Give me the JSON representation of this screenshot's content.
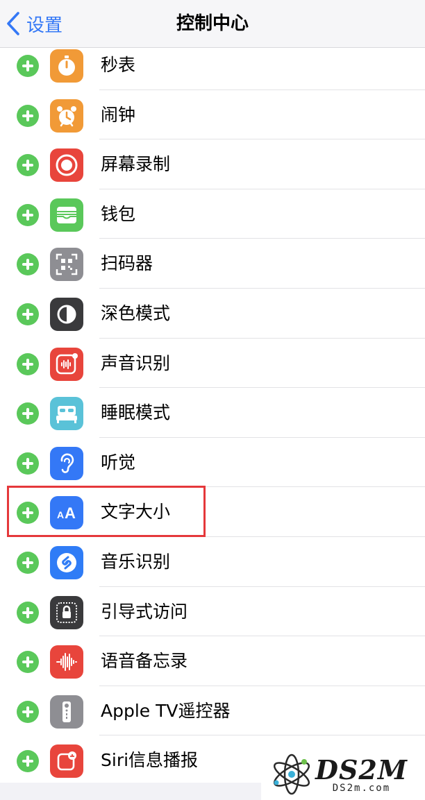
{
  "nav": {
    "back_label": "设置",
    "title": "控制中心"
  },
  "items": [
    {
      "label": "秒表",
      "icon": "stopwatch-icon",
      "color": "#f19a37"
    },
    {
      "label": "闹钟",
      "icon": "alarm-clock-icon",
      "color": "#f19a37"
    },
    {
      "label": "屏幕录制",
      "icon": "screen-record-icon",
      "color": "#e8453c"
    },
    {
      "label": "钱包",
      "icon": "wallet-icon",
      "color": "#5ac85a"
    },
    {
      "label": "扫码器",
      "icon": "qr-scanner-icon",
      "color": "#8e8e93"
    },
    {
      "label": "深色模式",
      "icon": "dark-mode-icon",
      "color": "#3a3a3c"
    },
    {
      "label": "声音识别",
      "icon": "sound-recognition-icon",
      "color": "#e8453c"
    },
    {
      "label": "睡眠模式",
      "icon": "bed-icon",
      "color": "#5ac2d8"
    },
    {
      "label": "听觉",
      "icon": "ear-icon",
      "color": "#3478f6"
    },
    {
      "label": "文字大小",
      "icon": "text-size-icon",
      "color": "#3478f6"
    },
    {
      "label": "音乐识别",
      "icon": "shazam-icon",
      "color": "#2f7cf6"
    },
    {
      "label": "引导式访问",
      "icon": "lock-icon",
      "color": "#3a3a3c"
    },
    {
      "label": "语音备忘录",
      "icon": "voice-memo-icon",
      "color": "#e8453c"
    },
    {
      "label": "Apple TV遥控器",
      "icon": "tv-remote-icon",
      "color": "#8e8e93"
    },
    {
      "label": "Siri信息播报",
      "icon": "siri-announce-icon",
      "color": "#e8453c"
    }
  ],
  "watermark": {
    "brand": "DS2M",
    "url": "DS2m.com"
  }
}
